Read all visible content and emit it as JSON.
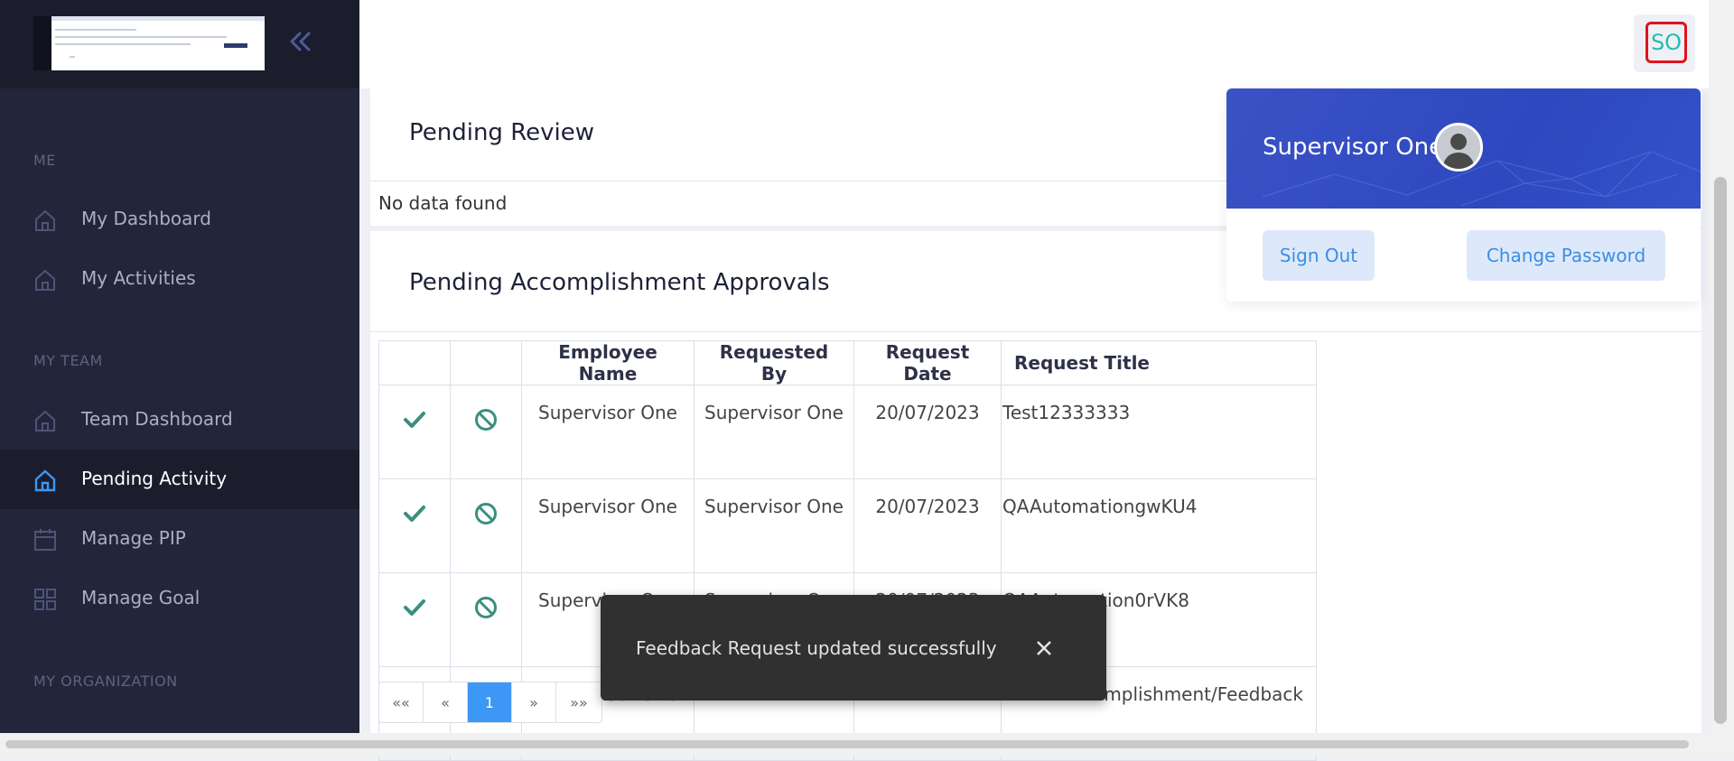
{
  "header": {
    "avatar_initials": "SO"
  },
  "sidebar": {
    "sections": [
      {
        "label": "ME"
      },
      {
        "label": "MY TEAM"
      },
      {
        "label": "MY ORGANIZATION"
      }
    ],
    "items": [
      {
        "label": "My Dashboard",
        "icon": "home-icon"
      },
      {
        "label": "My Activities",
        "icon": "home-icon"
      },
      {
        "label": "Team Dashboard",
        "icon": "home-icon"
      },
      {
        "label": "Pending Activity",
        "icon": "home-icon",
        "active": true
      },
      {
        "label": "Manage PIP",
        "icon": "calendar-icon"
      },
      {
        "label": "Manage Goal",
        "icon": "grid-icon"
      }
    ]
  },
  "pending_review": {
    "title": "Pending Review",
    "empty_text": "No data found"
  },
  "approvals": {
    "title": "Pending Accomplishment Approvals",
    "columns": [
      "",
      "",
      "Employee Name",
      "Requested By",
      "Request Date",
      "Request Title"
    ],
    "rows": [
      {
        "employee": "Supervisor One",
        "requested_by": "Supervisor One",
        "date": "20/07/2023",
        "title": "Test12333333"
      },
      {
        "employee": "Supervisor One",
        "requested_by": "Supervisor One",
        "date": "20/07/2023",
        "title": "QAAutomationgwKU4"
      },
      {
        "employee": "Supervisor One",
        "requested_by": "Supervisor One",
        "date": "20/07/2023",
        "title": "QAAutomation0rVK8"
      },
      {
        "employee": "Supervisor One",
        "requested_by": "",
        "date": "",
        "title": "mplishment/Feedback"
      }
    ],
    "pager": {
      "first": "««",
      "prev": "«",
      "current": "1",
      "next": "»",
      "last": "»»"
    }
  },
  "profile_menu": {
    "name": "Supervisor One",
    "sign_out": "Sign Out",
    "change_password": "Change Password"
  },
  "toast": {
    "message": "Feedback Request updated successfully"
  },
  "colors": {
    "sidebar_bg": "#23253a",
    "accent_blue": "#3d97f5",
    "check_green": "#3a8f7f",
    "highlight_red": "#e2121b",
    "initials_teal": "#26bcb1"
  }
}
